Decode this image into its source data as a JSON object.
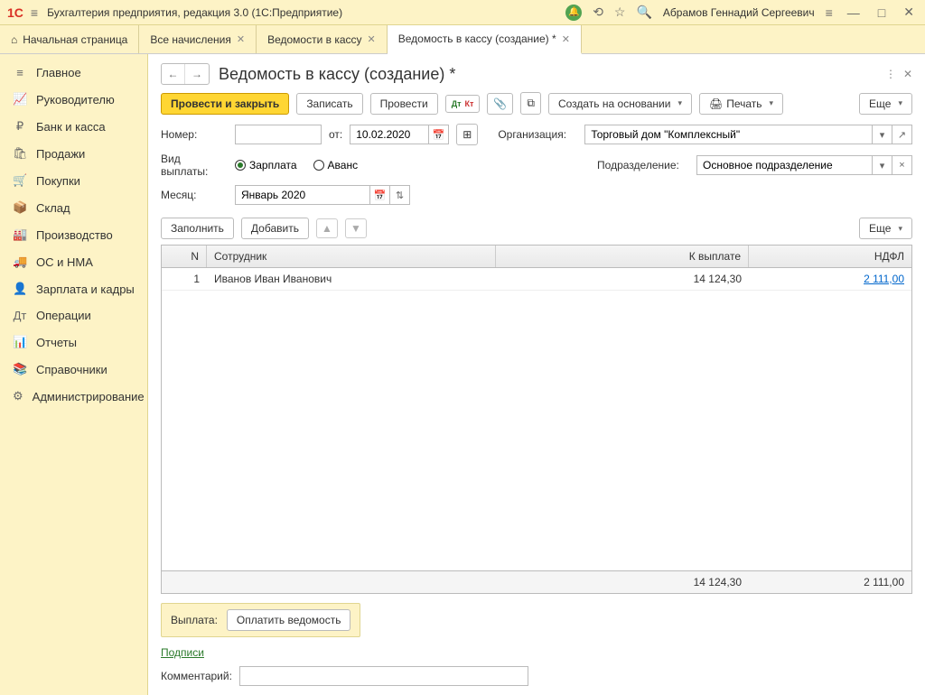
{
  "titlebar": {
    "app_title": "Бухгалтерия предприятия, редакция 3.0  (1С:Предприятие)",
    "user_name": "Абрамов Геннадий Сергеевич",
    "logo": "1С"
  },
  "tabs": {
    "home": "Начальная страница",
    "items": [
      {
        "label": "Все начисления"
      },
      {
        "label": "Ведомости в кассу"
      },
      {
        "label": "Ведомость в кассу (создание) *",
        "active": true
      }
    ]
  },
  "sidebar": {
    "items": [
      {
        "icon": "≡",
        "label": "Главное"
      },
      {
        "icon": "📈",
        "label": "Руководителю"
      },
      {
        "icon": "₽",
        "label": "Банк и касса"
      },
      {
        "icon": "🛍",
        "label": "Продажи"
      },
      {
        "icon": "🛒",
        "label": "Покупки"
      },
      {
        "icon": "📦",
        "label": "Склад"
      },
      {
        "icon": "🏭",
        "label": "Производство"
      },
      {
        "icon": "🚚",
        "label": "ОС и НМА"
      },
      {
        "icon": "👤",
        "label": "Зарплата и кадры"
      },
      {
        "icon": "Дт",
        "label": "Операции"
      },
      {
        "icon": "📊",
        "label": "Отчеты"
      },
      {
        "icon": "📚",
        "label": "Справочники"
      },
      {
        "icon": "⚙",
        "label": "Администрирование"
      }
    ]
  },
  "document": {
    "title": "Ведомость в кассу (создание) *",
    "toolbar": {
      "post_close": "Провести и закрыть",
      "save": "Записать",
      "post": "Провести",
      "create_based": "Создать на основании",
      "print": "Печать",
      "more": "Еще"
    },
    "form": {
      "number_label": "Номер:",
      "number_value": "",
      "from_label": "от:",
      "date_value": "10.02.2020",
      "org_label": "Организация:",
      "org_value": "Торговый дом \"Комплексный\"",
      "paytype_label": "Вид выплаты:",
      "paytype_salary": "Зарплата",
      "paytype_advance": "Аванс",
      "dept_label": "Подразделение:",
      "dept_value": "Основное подразделение",
      "month_label": "Месяц:",
      "month_value": "Январь 2020"
    },
    "table_toolbar": {
      "fill": "Заполнить",
      "add": "Добавить",
      "more": "Еще"
    },
    "table": {
      "headers": {
        "n": "N",
        "employee": "Сотрудник",
        "pay": "К выплате",
        "ndfl": "НДФЛ"
      },
      "rows": [
        {
          "n": "1",
          "employee": "Иванов Иван Иванович",
          "pay": "14 124,30",
          "ndfl": "2 111,00"
        }
      ],
      "totals": {
        "pay": "14 124,30",
        "ndfl": "2 111,00"
      }
    },
    "footer": {
      "pay_label": "Выплата:",
      "pay_button": "Оплатить ведомость",
      "sign_link": "Подписи",
      "comment_label": "Комментарий:",
      "comment_value": ""
    }
  }
}
